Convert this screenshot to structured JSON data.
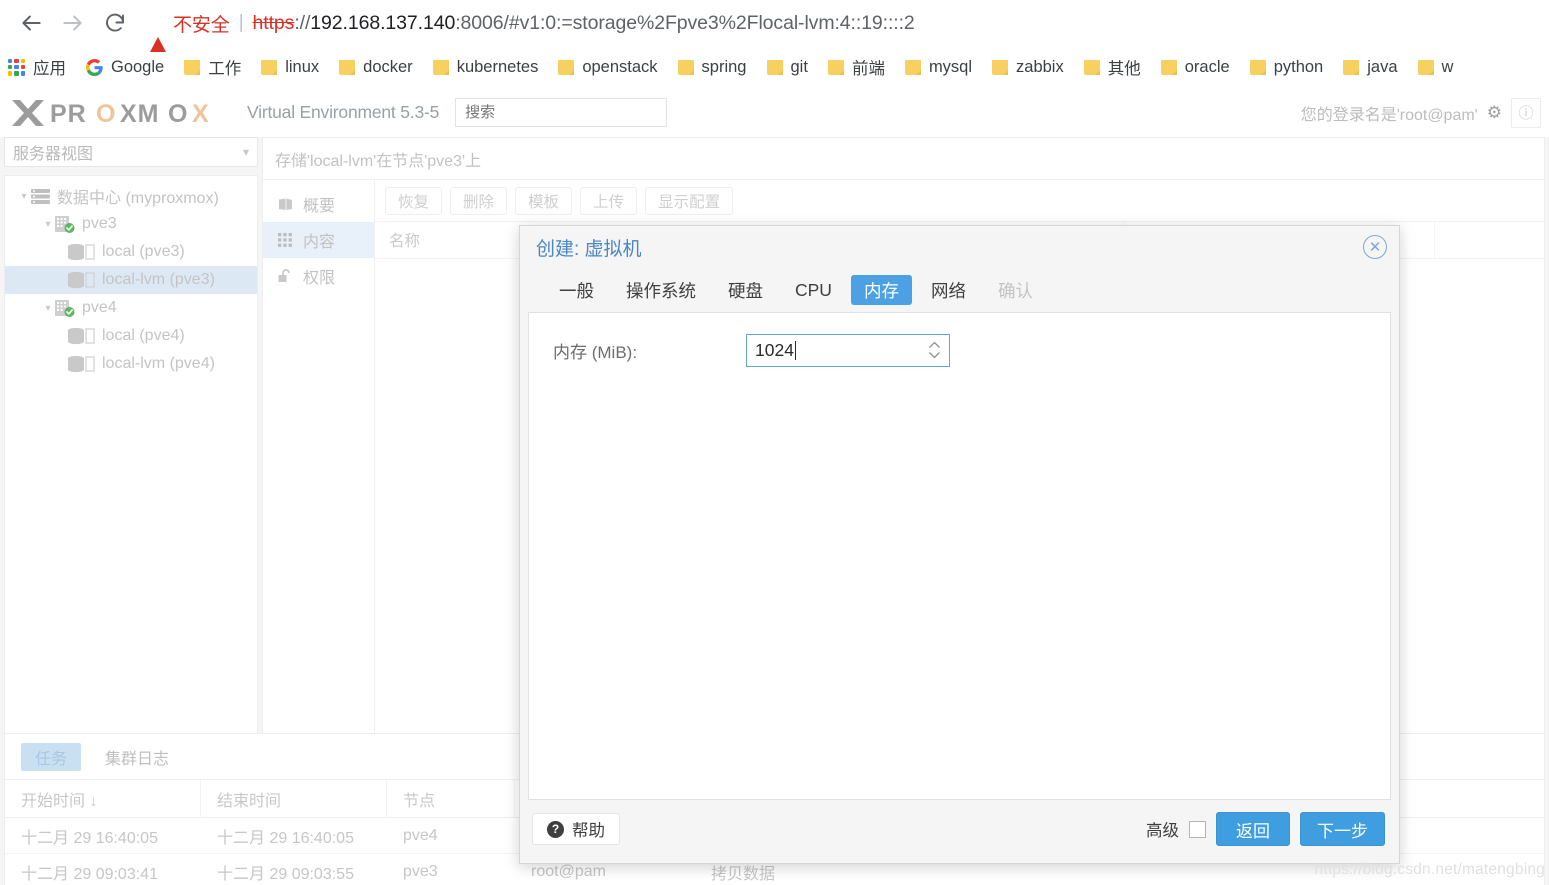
{
  "browser": {
    "nav": {
      "back_icon": "arrow-left-icon",
      "forward_icon": "arrow-right-icon",
      "reload_icon": "reload-icon"
    },
    "omnibox": {
      "security_label": "不安全",
      "security_icon": "warning-triangle-icon",
      "url_scheme": "https",
      "url_scheme_sep": "://",
      "url_host": "192.168.137.140",
      "url_rest": ":8006/#v1:0:=storage%2Fpve3%2Flocal-lvm:4::19::::2"
    },
    "bookmarks": [
      {
        "label": "应用",
        "icon": "apps-grid-icon"
      },
      {
        "label": "Google",
        "icon": "google-logo-icon"
      },
      {
        "label": "工作",
        "icon": "folder-icon"
      },
      {
        "label": "linux",
        "icon": "folder-icon"
      },
      {
        "label": "docker",
        "icon": "folder-icon"
      },
      {
        "label": "kubernetes",
        "icon": "folder-icon"
      },
      {
        "label": "openstack",
        "icon": "folder-icon"
      },
      {
        "label": "spring",
        "icon": "folder-icon"
      },
      {
        "label": "git",
        "icon": "folder-icon"
      },
      {
        "label": "前端",
        "icon": "folder-icon"
      },
      {
        "label": "mysql",
        "icon": "folder-icon"
      },
      {
        "label": "zabbix",
        "icon": "folder-icon"
      },
      {
        "label": "其他",
        "icon": "folder-icon"
      },
      {
        "label": "oracle",
        "icon": "folder-icon"
      },
      {
        "label": "python",
        "icon": "folder-icon"
      },
      {
        "label": "java",
        "icon": "folder-icon"
      },
      {
        "label": "w",
        "icon": "folder-icon"
      }
    ]
  },
  "pve": {
    "brand": "PROXMOX",
    "product": "Virtual Environment 5.3-5",
    "search_placeholder": "搜索",
    "user_text": "您的登录名是'root@pam'",
    "gear_icon": "gear-icon",
    "view_select": "服务器视图",
    "tree": [
      {
        "label": "数据中心 (myproxmox)",
        "level": 0,
        "icon": "datacenter-icon",
        "expanded": true,
        "selected": false
      },
      {
        "label": "pve3",
        "level": 1,
        "icon": "node-online-icon",
        "expanded": true,
        "selected": false
      },
      {
        "label": "local (pve3)",
        "level": 2,
        "icon": "storage-icon",
        "expanded": false,
        "selected": false
      },
      {
        "label": "local-lvm (pve3)",
        "level": 2,
        "icon": "storage-icon",
        "expanded": false,
        "selected": true
      },
      {
        "label": "pve4",
        "level": 1,
        "icon": "node-online-icon",
        "expanded": true,
        "selected": false
      },
      {
        "label": "local (pve4)",
        "level": 2,
        "icon": "storage-icon",
        "expanded": false,
        "selected": false
      },
      {
        "label": "local-lvm (pve4)",
        "level": 2,
        "icon": "storage-icon",
        "expanded": false,
        "selected": false
      }
    ],
    "content_title": "存储'local-lvm'在节点'pve3'上",
    "content_nav": [
      {
        "label": "概要",
        "icon": "book-icon",
        "active": false
      },
      {
        "label": "内容",
        "icon": "grid-icon",
        "active": true
      },
      {
        "label": "权限",
        "icon": "unlock-icon",
        "active": false
      }
    ],
    "toolbar_buttons": [
      {
        "label": "恢复",
        "disabled": true
      },
      {
        "label": "删除",
        "disabled": true
      },
      {
        "label": "模板",
        "disabled": true
      },
      {
        "label": "上传",
        "disabled": true
      },
      {
        "label": "显示配置",
        "disabled": true
      }
    ],
    "grid_headers": [
      "名称"
    ]
  },
  "tasks": {
    "tabs": [
      {
        "label": "任务",
        "active": true
      },
      {
        "label": "集群日志",
        "active": false
      }
    ],
    "columns": [
      "开始时间 ↓",
      "结束时间",
      "节点",
      "",
      ""
    ],
    "rows": [
      {
        "start": "十二月 29 16:40:05",
        "end": "十二月 29 16:40:05",
        "node": "pve4",
        "user": "",
        "desc": ""
      },
      {
        "start": "十二月 29 09:03:41",
        "end": "十二月 29 09:03:55",
        "node": "pve3",
        "user": "root@pam",
        "desc": "拷贝数据"
      }
    ]
  },
  "dialog": {
    "title": "创建: 虚拟机",
    "close_icon": "close-circle-icon",
    "tabs": [
      {
        "label": "一般",
        "active": false,
        "disabled": false
      },
      {
        "label": "操作系统",
        "active": false,
        "disabled": false
      },
      {
        "label": "硬盘",
        "active": false,
        "disabled": false
      },
      {
        "label": "CPU",
        "active": false,
        "disabled": false
      },
      {
        "label": "内存",
        "active": true,
        "disabled": false
      },
      {
        "label": "网络",
        "active": false,
        "disabled": false
      },
      {
        "label": "确认",
        "active": false,
        "disabled": true
      }
    ],
    "form": {
      "memory_label": "内存 (MiB):",
      "memory_value": "1024"
    },
    "footer": {
      "help_label": "帮助",
      "help_icon": "question-circle-icon",
      "advanced_label": "高级",
      "advanced_checked": false,
      "back_label": "返回",
      "next_label": "下一步"
    }
  },
  "watermark": "https://blog.csdn.net/matengbing",
  "colors": {
    "accent_blue": "#4ba1e3",
    "danger_red": "#d93025",
    "selected_row": "#dce9f5",
    "folder_yellow": "#f7d060"
  }
}
